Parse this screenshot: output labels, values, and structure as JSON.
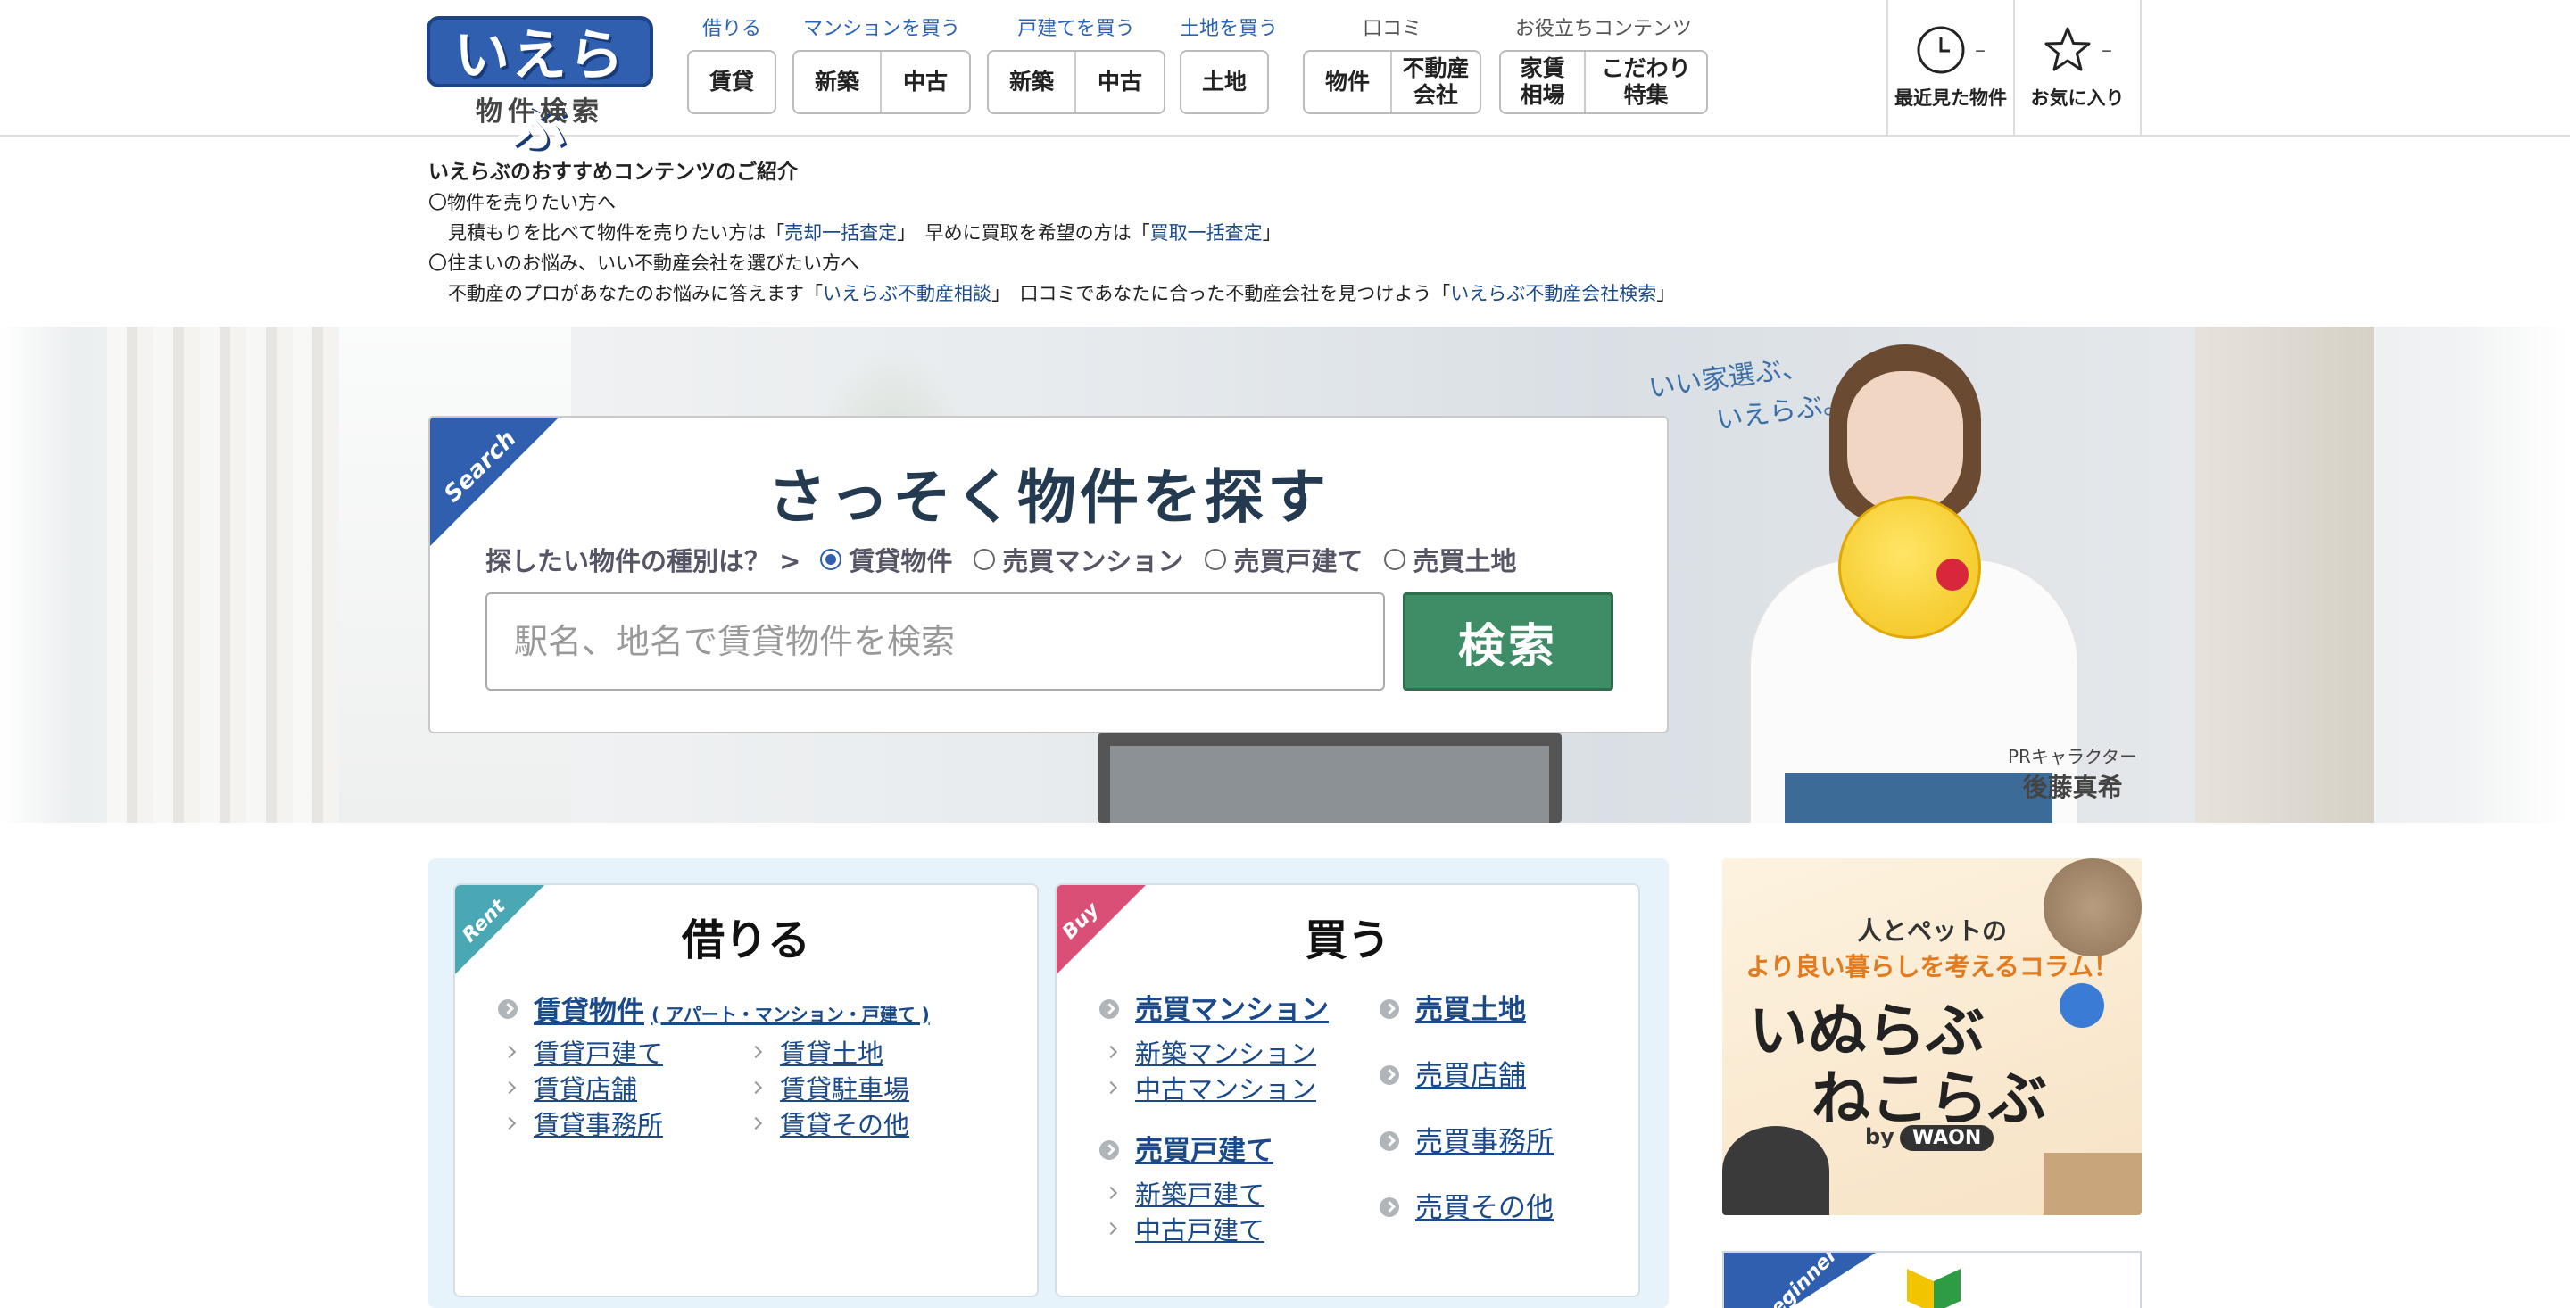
{
  "logo": {
    "main": "いえらぶ",
    "sub": "物件検索"
  },
  "nav": [
    {
      "label": "借りる",
      "buttons": [
        "賃貸"
      ]
    },
    {
      "label": "マンションを買う",
      "buttons": [
        "新築",
        "中古"
      ]
    },
    {
      "label": "戸建てを買う",
      "buttons": [
        "新築",
        "中古"
      ]
    },
    {
      "label": "土地を買う",
      "buttons": [
        "土地"
      ]
    },
    {
      "label": "口コミ",
      "buttons": [
        "物件",
        "不動産\n会社"
      ]
    },
    {
      "label": "お役立ちコンテンツ",
      "buttons": [
        "家賃\n相場",
        "こだわり\n特集"
      ]
    }
  ],
  "header_right": {
    "recent": {
      "count": "–",
      "label": "最近見た物件"
    },
    "favorites": {
      "count": "–",
      "label": "お気に入り"
    }
  },
  "recommend": {
    "title": "いえらぶのおすすめコンテンツのご紹介",
    "sell_heading": "〇物件を売りたい方へ",
    "sell_text1": "見積もりを比べて物件を売りたい方は「",
    "sell_link1": "売却一括査定",
    "sell_text2": "」　早めに買取を希望の方は「",
    "sell_link2": "買取一括査定",
    "sell_text3": "」",
    "live_heading": "〇住まいのお悩み、いい不動産会社を選びたい方へ",
    "live_text1": "不動産のプロがあなたのお悩みに答えます「",
    "live_link1": "いえらぶ不動産相談",
    "live_text2": "」　口コミであなたに合った不動産会社を見つけよう「",
    "live_link2": "いえらぶ不動産会社検索",
    "live_text3": "」"
  },
  "hero": {
    "catch1": "いい家選ぶ、",
    "catch2": "いえらぶ。",
    "pr_label": "PRキャラクター",
    "pr_name": "後藤真希"
  },
  "search": {
    "corner": "Search",
    "title": "さっそく物件を探す",
    "question": "探したい物件の種別は？ >",
    "options": [
      "賃貸物件",
      "売買マンション",
      "売買戸建て",
      "売買土地"
    ],
    "selected": "賃貸物件",
    "placeholder": "駅名、地名で賃貸物件を検索",
    "button": "検索"
  },
  "rent": {
    "badge": "Rent",
    "title": "借りる",
    "main_link": "賃貸物件",
    "main_sub": "( アパート・マンション・戸建て )",
    "links": [
      "賃貸戸建て",
      "賃貸土地",
      "賃貸店舗",
      "賃貸駐車場",
      "賃貸事務所",
      "賃貸その他"
    ]
  },
  "buy": {
    "badge": "Buy",
    "title": "買う",
    "mansion": "売買マンション",
    "mansion_links": [
      "新築マンション",
      "中古マンション"
    ],
    "house": "売買戸建て",
    "house_links": [
      "新築戸建て",
      "中古戸建て"
    ],
    "land": "売買土地",
    "others": [
      "売買店舗",
      "売買事務所",
      "売買その他"
    ]
  },
  "ad": {
    "line1": "人とペットの",
    "line2": "より良い暮らしを考えるコラム！",
    "line3": "いぬらぶ",
    "line4": "ねこらぶ",
    "by": "by",
    "brand": "WAON"
  },
  "ad2": {
    "corner": "Beginner"
  }
}
